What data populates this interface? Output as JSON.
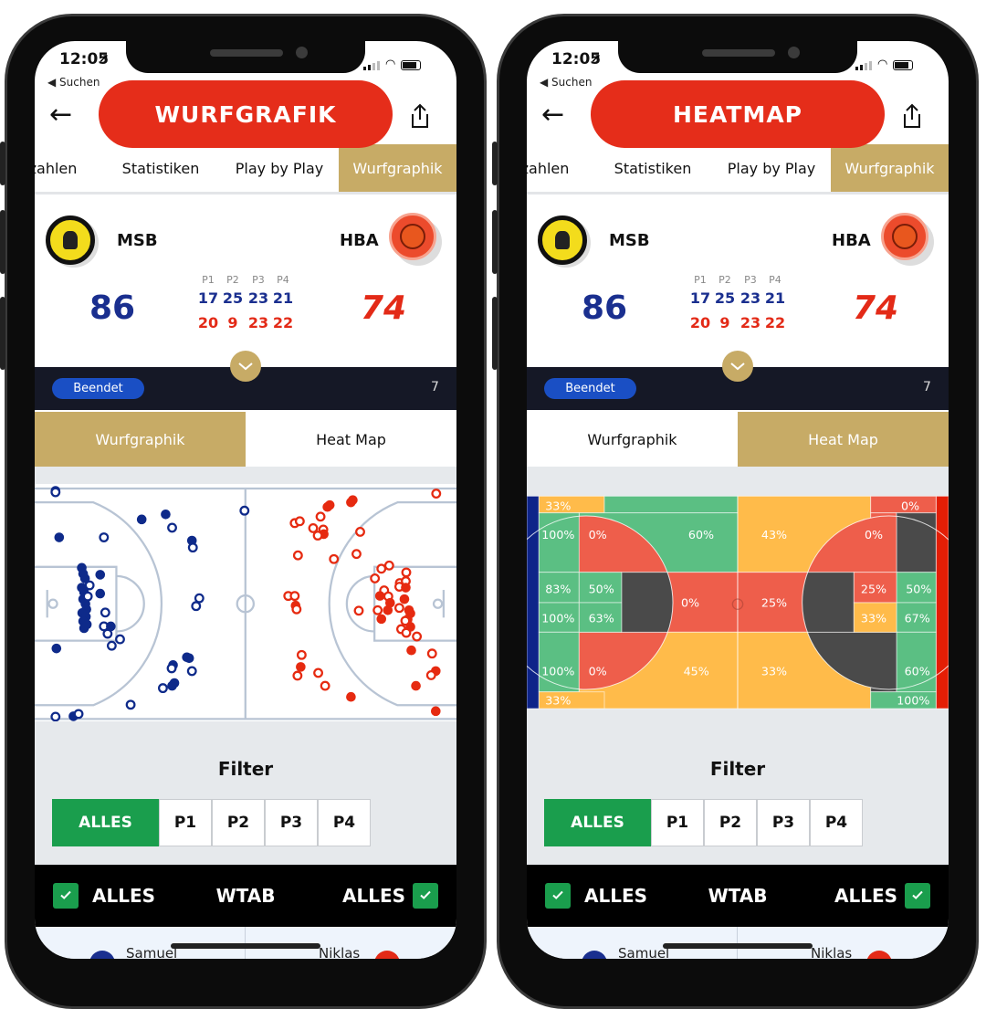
{
  "colors": {
    "gold": "#c7ab66",
    "blue": "#1a2f8f",
    "red": "#e32a17",
    "green": "#1a9e4d",
    "banner": "#e52d1a",
    "heat_green": "#5bbf83",
    "heat_red": "#ee5e4b",
    "heat_orange": "#ffbb4a",
    "heat_dark": "#4a4a4a"
  },
  "phones": [
    {
      "status": {
        "time": "12:05",
        "back_app": "◀ Suchen"
      },
      "banner": "WURFGRAFIK",
      "tabs": [
        {
          "label": "zahlen"
        },
        {
          "label": "Statistiken"
        },
        {
          "label": "Play by Play"
        },
        {
          "label": "Wurfgraphik",
          "active": true
        }
      ],
      "home": {
        "name": "MSB",
        "score": "86",
        "quarters": [
          "17",
          "25",
          "23",
          "21"
        ]
      },
      "away": {
        "name": "HBA",
        "score": "74",
        "quarters": [
          "20",
          "9",
          "23",
          "22"
        ]
      },
      "quarter_labels": [
        "P1",
        "P2",
        "P3",
        "P4"
      ],
      "status_badge": "Beendet",
      "status_count": "7",
      "subtabs": [
        {
          "label": "Wurfgraphik",
          "active": true
        },
        {
          "label": "Heat Map",
          "active": false
        }
      ],
      "view": "shots",
      "filter": {
        "title": "Filter",
        "options": [
          "ALLES",
          "P1",
          "P2",
          "P3",
          "P4"
        ],
        "selected": "ALLES"
      },
      "teambar": {
        "left": "ALLES",
        "center": "WTAB",
        "right": "ALLES",
        "left_checked": true,
        "right_checked": true
      },
      "players": {
        "left": "Samuel",
        "right": "Niklas"
      }
    },
    {
      "status": {
        "time": "12:05",
        "back_app": "◀ Suchen"
      },
      "banner": "HEATMAP",
      "tabs": [
        {
          "label": "zahlen"
        },
        {
          "label": "Statistiken"
        },
        {
          "label": "Play by Play"
        },
        {
          "label": "Wurfgraphik",
          "active": true
        }
      ],
      "home": {
        "name": "MSB",
        "score": "86",
        "quarters": [
          "17",
          "25",
          "23",
          "21"
        ]
      },
      "away": {
        "name": "HBA",
        "score": "74",
        "quarters": [
          "20",
          "9",
          "23",
          "22"
        ]
      },
      "quarter_labels": [
        "P1",
        "P2",
        "P3",
        "P4"
      ],
      "status_badge": "Beendet",
      "status_count": "7",
      "subtabs": [
        {
          "label": "Wurfgraphik",
          "active": false
        },
        {
          "label": "Heat Map",
          "active": true
        }
      ],
      "view": "heatmap",
      "filter": {
        "title": "Filter",
        "options": [
          "ALLES",
          "P1",
          "P2",
          "P3",
          "P4"
        ],
        "selected": "ALLES"
      },
      "teambar": {
        "left": "ALLES",
        "center": "WTAB",
        "right": "ALLES",
        "left_checked": true,
        "right_checked": true
      },
      "players": {
        "left": "Samuel",
        "right": "Niklas"
      }
    }
  ],
  "chart_data": [
    {
      "type": "scatter",
      "description_units": "court feet (x 0-94 baseline to baseline, y 0-50 sideline to sideline)",
      "series": [
        {
          "name": "MSB",
          "color": "#0e2a8a",
          "shots": [
            [
              5.8,
              0.5,
              1
            ],
            [
              5.8,
              0.8,
              0
            ],
            [
              6.6,
              10.6,
              1
            ],
            [
              16.3,
              10.6,
              0
            ],
            [
              24.5,
              6.7,
              1
            ],
            [
              29.7,
              5.6,
              1
            ],
            [
              31.1,
              8.5,
              0
            ],
            [
              35.4,
              11.3,
              1
            ],
            [
              35.6,
              12.8,
              0
            ],
            [
              46.8,
              4.8,
              0
            ],
            [
              37.0,
              23.8,
              0
            ],
            [
              36.3,
              25.5,
              0
            ],
            [
              11.5,
              17.2,
              1
            ],
            [
              11.8,
              18.5,
              1
            ],
            [
              12.2,
              19.5,
              1
            ],
            [
              11.5,
              21.5,
              1
            ],
            [
              12.0,
              22.5,
              1
            ],
            [
              11.8,
              24.0,
              1
            ],
            [
              12.3,
              25.0,
              1
            ],
            [
              12.5,
              26.2,
              1
            ],
            [
              11.6,
              27.0,
              1
            ],
            [
              12.4,
              27.8,
              1
            ],
            [
              11.8,
              28.8,
              1
            ],
            [
              12.6,
              29.5,
              1
            ],
            [
              12.0,
              30.3,
              1
            ],
            [
              15.5,
              18.7,
              1
            ],
            [
              15.5,
              22.8,
              1
            ],
            [
              13.2,
              21.0,
              0
            ],
            [
              12.8,
              23.4,
              0
            ],
            [
              16.6,
              26.9,
              0
            ],
            [
              16.3,
              29.9,
              0
            ],
            [
              17.8,
              29.9,
              1
            ],
            [
              17.1,
              31.5,
              0
            ],
            [
              19.8,
              32.7,
              0
            ],
            [
              18.0,
              34.1,
              0
            ],
            [
              6.0,
              34.7,
              1
            ],
            [
              34.3,
              36.6,
              1
            ],
            [
              34.8,
              36.8,
              1
            ],
            [
              35.4,
              39.6,
              0
            ],
            [
              31.3,
              38.3,
              1
            ],
            [
              31.0,
              39.0,
              0
            ],
            [
              31.6,
              42.2,
              1
            ],
            [
              31.1,
              42.8,
              1
            ],
            [
              29.1,
              43.3,
              0
            ],
            [
              22.1,
              46.9,
              0
            ],
            [
              5.8,
              49.5,
              0
            ],
            [
              9.7,
              49.4,
              1
            ],
            [
              10.8,
              48.9,
              0
            ]
          ]
        },
        {
          "name": "HBA",
          "color": "#e62a10",
          "shots": [
            [
              88.4,
              1.1,
              0
            ],
            [
              65.3,
              3.6,
              1
            ],
            [
              64.8,
              4.0,
              1
            ],
            [
              70.3,
              2.5,
              1
            ],
            [
              69.9,
              3.0,
              1
            ],
            [
              57.7,
              7.5,
              0
            ],
            [
              58.8,
              7.1,
              0
            ],
            [
              63.3,
              6.1,
              0
            ],
            [
              61.7,
              8.6,
              0
            ],
            [
              63.9,
              8.9,
              0
            ],
            [
              64.0,
              9.9,
              1
            ],
            [
              62.7,
              10.2,
              0
            ],
            [
              71.9,
              9.4,
              0
            ],
            [
              58.4,
              14.5,
              0
            ],
            [
              66.2,
              15.3,
              0
            ],
            [
              71.1,
              14.2,
              0
            ],
            [
              76.5,
              17.4,
              0
            ],
            [
              78.2,
              16.7,
              0
            ],
            [
              81.9,
              18.2,
              0
            ],
            [
              75.1,
              19.5,
              0
            ],
            [
              80.5,
              20.5,
              0
            ],
            [
              81.8,
              20.1,
              0
            ],
            [
              80.4,
              21.3,
              0
            ],
            [
              81.8,
              21.5,
              1
            ],
            [
              77.1,
              22.1,
              0
            ],
            [
              76.2,
              23.3,
              1
            ],
            [
              78.0,
              23.4,
              0
            ],
            [
              78.4,
              24.8,
              1
            ],
            [
              81.5,
              24.0,
              1
            ],
            [
              56.3,
              23.3,
              0
            ],
            [
              57.7,
              23.3,
              0
            ],
            [
              57.9,
              25.4,
              1
            ],
            [
              58.1,
              26.2,
              0
            ],
            [
              71.6,
              26.5,
              0
            ],
            [
              75.7,
              26.4,
              0
            ],
            [
              77.9,
              26.4,
              1
            ],
            [
              80.4,
              25.9,
              0
            ],
            [
              82.5,
              26.4,
              1
            ],
            [
              82.8,
              27.1,
              1
            ],
            [
              76.5,
              28.3,
              1
            ],
            [
              82.2,
              28.4,
              1
            ],
            [
              81.7,
              28.7,
              0
            ],
            [
              82.8,
              30.0,
              1
            ],
            [
              80.8,
              30.5,
              0
            ],
            [
              81.9,
              31.3,
              0
            ],
            [
              84.2,
              32.1,
              0
            ],
            [
              83.0,
              35.1,
              1
            ],
            [
              87.5,
              35.8,
              0
            ],
            [
              59.2,
              36.1,
              0
            ],
            [
              59.0,
              38.7,
              1
            ],
            [
              58.3,
              40.6,
              0
            ],
            [
              62.8,
              40.0,
              0
            ],
            [
              64.3,
              42.8,
              0
            ],
            [
              88.3,
              39.6,
              1
            ],
            [
              87.3,
              40.5,
              0
            ],
            [
              84.0,
              42.8,
              1
            ],
            [
              69.9,
              45.2,
              1
            ],
            [
              88.3,
              48.3,
              1
            ]
          ]
        }
      ],
      "legend": "filled = made, open = missed"
    },
    {
      "type": "heatmap",
      "zones": [
        {
          "zone": "left-top-corner",
          "value": "33%",
          "level": "orange"
        },
        {
          "zone": "left-top-baseline",
          "value": "100%",
          "level": "green"
        },
        {
          "zone": "left-top-midrange",
          "value": "0%",
          "level": "red"
        },
        {
          "zone": "left-top-three",
          "value": "60%",
          "level": "green"
        },
        {
          "zone": "left-paint-top-outer",
          "value": "83%",
          "level": "green"
        },
        {
          "zone": "left-paint-top-inner",
          "value": "50%",
          "level": "green"
        },
        {
          "zone": "left-paint-bottom-outer",
          "value": "100%",
          "level": "green"
        },
        {
          "zone": "left-paint-bottom-inner",
          "value": "63%",
          "level": "green"
        },
        {
          "zone": "left-top-of-key-three",
          "value": "0%",
          "level": "red"
        },
        {
          "zone": "left-bottom-baseline",
          "value": "100%",
          "level": "green"
        },
        {
          "zone": "left-bottom-midrange",
          "value": "0%",
          "level": "red"
        },
        {
          "zone": "left-bottom-three",
          "value": "45%",
          "level": "orange"
        },
        {
          "zone": "left-bottom-corner",
          "value": "33%",
          "level": "orange"
        },
        {
          "zone": "right-top-three",
          "value": "43%",
          "level": "orange"
        },
        {
          "zone": "right-top-corner",
          "value": "0%",
          "level": "red"
        },
        {
          "zone": "right-top-midrange",
          "value": "0%",
          "level": "red"
        },
        {
          "zone": "right-top-of-key-three",
          "value": "25%",
          "level": "red"
        },
        {
          "zone": "right-paint-top-inner",
          "value": "25%",
          "level": "red"
        },
        {
          "zone": "right-paint-top-outer",
          "value": "50%",
          "level": "green"
        },
        {
          "zone": "right-paint-bottom-inner",
          "value": "33%",
          "level": "orange"
        },
        {
          "zone": "right-paint-bottom-outer",
          "value": "67%",
          "level": "green"
        },
        {
          "zone": "right-bottom-three",
          "value": "33%",
          "level": "orange"
        },
        {
          "zone": "right-bottom-baseline",
          "value": "60%",
          "level": "green"
        },
        {
          "zone": "right-bottom-corner",
          "value": "100%",
          "level": "green"
        }
      ]
    }
  ]
}
